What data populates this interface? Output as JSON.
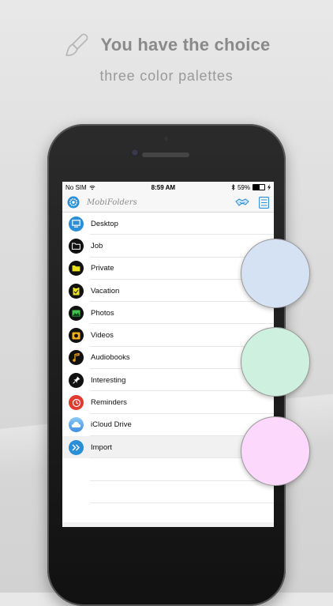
{
  "headline": {
    "title": "You have the choice",
    "subtitle": "three color palettes"
  },
  "status_bar": {
    "carrier": "No SIM",
    "time": "8:59 AM",
    "battery": "59%",
    "battery_level": 0.59
  },
  "navbar": {
    "app_title": "MobiFolders"
  },
  "folders": [
    {
      "label": "Desktop",
      "icon": "monitor-icon",
      "color": "#2a8fd6"
    },
    {
      "label": "Job",
      "icon": "folder-icon",
      "color": "#111111"
    },
    {
      "label": "Private",
      "icon": "folder-icon",
      "color": "#111111"
    },
    {
      "label": "Vacation",
      "icon": "clipboard-icon",
      "color": "#111111"
    },
    {
      "label": "Photos",
      "icon": "photo-icon",
      "color": "#111111"
    },
    {
      "label": "Videos",
      "icon": "film-icon",
      "color": "#111111"
    },
    {
      "label": "Audiobooks",
      "icon": "music-note-icon",
      "color": "#111111"
    },
    {
      "label": "Interesting",
      "icon": "pin-icon",
      "color": "#111111"
    },
    {
      "label": "Reminders",
      "icon": "clock-icon",
      "color": "#e03b2f"
    },
    {
      "label": "iCloud Drive",
      "icon": "cloud-icon",
      "color": "#5aa8e8"
    },
    {
      "label": "Import",
      "icon": "double-chevron-right-icon",
      "color": "#2a8fd6"
    }
  ],
  "palettes": [
    "#d4e2f4",
    "#cdf0df",
    "#fcd8fc"
  ],
  "colors": {
    "accent": "#2a8fd6",
    "headline_text": "#8a8a8a"
  }
}
